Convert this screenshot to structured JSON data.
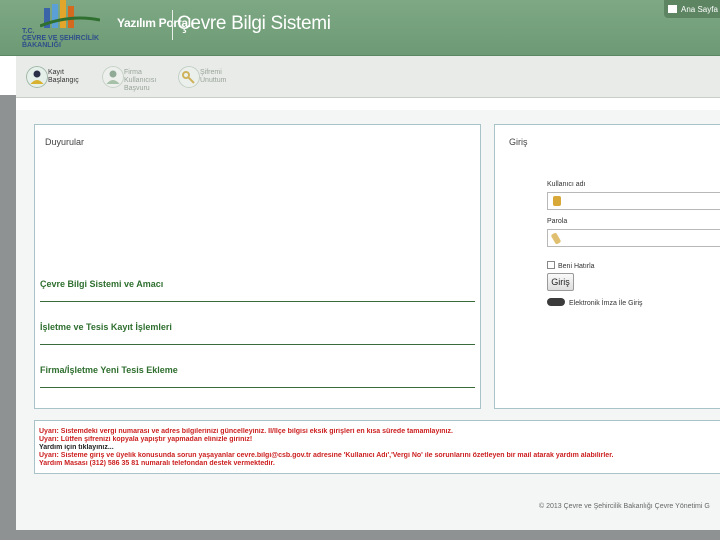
{
  "header": {
    "logo_text_lines": [
      "T.C.",
      "ÇEVRE VE ŞEHİRCİLİK",
      "BAKANLIĞI"
    ],
    "portal_label": "Yazılım Portalı",
    "system_title": "Çevre Bilgi Sistemi",
    "home_label": "Ana Sayfa"
  },
  "toolbar": {
    "items": [
      {
        "line1": "Kayıt",
        "line2": "Başlangıç",
        "line3": ""
      },
      {
        "line1": "Firma",
        "line2": "Kullanıcısı",
        "line3": "Başvuru"
      },
      {
        "line1": "Şifremi",
        "line2": "Unuttum",
        "line3": ""
      }
    ]
  },
  "announcements": {
    "title": "Duyurular",
    "links": [
      "Çevre Bilgi Sistemi ve Amacı",
      "İşletme ve Tesis Kayıt İşlemleri",
      "Firma/İşletme Yeni Tesis Ekleme"
    ]
  },
  "login": {
    "title": "Giriş",
    "username_label": "Kullanıcı adı",
    "password_label": "Parola",
    "remember_label": "Beni Hatırla",
    "submit_label": "Giriş",
    "esign_label": "Elektronik İmza İle Giriş"
  },
  "warnings": {
    "lines": [
      "Uyarı: Sistemdeki vergi numarası ve adres bilgilerinizi güncelleyiniz. İl/İlçe bilgisi eksik girişleri en kısa sürede tamamlayınız.",
      "Uyarı: Lütfen şifrenizi kopyala yapıştır yapmadan elinizle giriniz!",
      "Yardım için tıklayınız...",
      "Uyarı: Sisteme giriş ve üyelik konusunda sorun yaşayanlar cevre.bilgi@csb.gov.tr adresine 'Kullanıcı Adı','Vergi No' ile sorunlarını özetleyen bir mail atarak yardım alabilirler.",
      "Yardım Masası (312) 586 35 81 numaralı telefondan destek vermektedir."
    ]
  },
  "footer": {
    "copyright": "© 2013 Çevre ve Şehircilik Bakanlığı Çevre Yönetimi G"
  },
  "colors": {
    "header_green": "#6d9a75",
    "link_green": "#2f6f2f",
    "warning_red": "#cc1f1f",
    "panel_border": "#a9c4c9"
  },
  "icons": {
    "home": "home-icon",
    "user_lock": "user-lock-icon",
    "password_key": "key-icon"
  }
}
